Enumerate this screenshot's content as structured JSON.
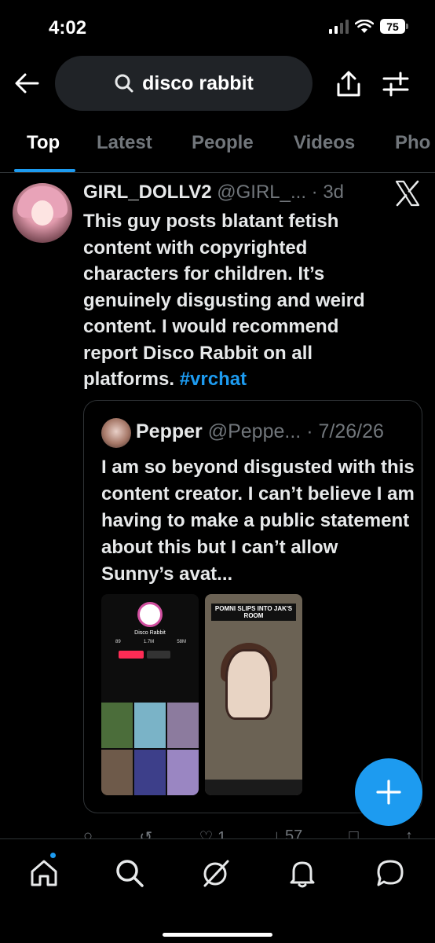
{
  "status_bar": {
    "time": "4:02",
    "battery": "75"
  },
  "search": {
    "query": "disco rabbit"
  },
  "tabs": [
    {
      "label": "Top",
      "active": true
    },
    {
      "label": "Latest"
    },
    {
      "label": "People"
    },
    {
      "label": "Videos"
    },
    {
      "label": "Pho"
    }
  ],
  "post": {
    "author_name": "GIRL_DOLLV2",
    "author_handle": "@GIRL_...",
    "separator": "·",
    "time": "3d",
    "text": "This guy posts blatant fetish content with copyrighted characters for children. It’s genuinely disgusting and weird content. I would recommend report Disco Rabbit on all platforms. ",
    "hashtag": "#vrchat",
    "quote": {
      "author_name": "Pepper",
      "author_handle": "@Peppe...",
      "separator": "·",
      "date": "7/26/26",
      "text": "I am so beyond disgusted with this content creator. I can’t believe I am having to make a public statement about this but I can’t allow Sunny’s avat...",
      "image1": {
        "name": "Disco Rabbit",
        "stats": [
          "89",
          "1.7M",
          "58M"
        ]
      },
      "image2": {
        "title": "POMNI SLIPS INTO JAK'S ROOM"
      }
    },
    "actions": {
      "likes": "1",
      "views": "57"
    }
  },
  "colors": {
    "accent": "#1d9bf0",
    "muted": "#71767b",
    "background": "#000000"
  }
}
